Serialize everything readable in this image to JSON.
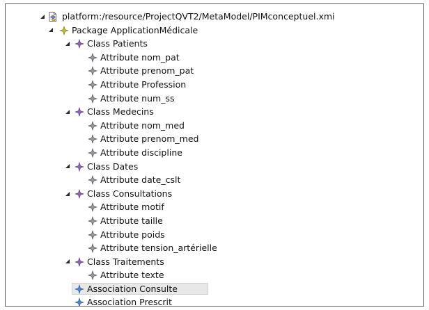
{
  "tree": {
    "resource_label": "platform:/resource/ProjectQVT2/MetaModel/PIMconceptuel.xmi",
    "package": {
      "label": "Package ApplicationMédicale"
    },
    "classes": [
      {
        "label": "Class Patients",
        "attributes": [
          "Attribute nom_pat",
          "Attribute prenom_pat",
          "Attribute Profession",
          "Attribute num_ss"
        ]
      },
      {
        "label": "Class Medecins",
        "attributes": [
          "Attribute nom_med",
          "Attribute prenom_med",
          "Attribute discipline"
        ]
      },
      {
        "label": "Class Dates",
        "attributes": [
          "Attribute date_cslt"
        ]
      },
      {
        "label": "Class Consultations",
        "attributes": [
          "Attribute motif",
          "Attribute taille",
          "Attribute poids",
          "Attribute tension_artérielle"
        ]
      },
      {
        "label": "Class Traitements",
        "attributes": [
          "Attribute texte"
        ]
      }
    ],
    "associations": [
      {
        "label": "Association Consulte",
        "selected": true
      },
      {
        "label": "Association Prescrit",
        "selected": false
      }
    ]
  },
  "colors": {
    "package_icon": "#c8b84a",
    "class_icon": "#8a6bb0",
    "attribute_icon": "#9a9aa2",
    "association_icon": "#5a86c8",
    "selection_bg": "#e8e8e8"
  },
  "icons": {
    "expanded": "triangle-down-right-icon",
    "resource": "xmi-resource-icon",
    "package": "package-icon",
    "class": "class-icon",
    "attribute": "attribute-icon",
    "association": "association-icon"
  }
}
